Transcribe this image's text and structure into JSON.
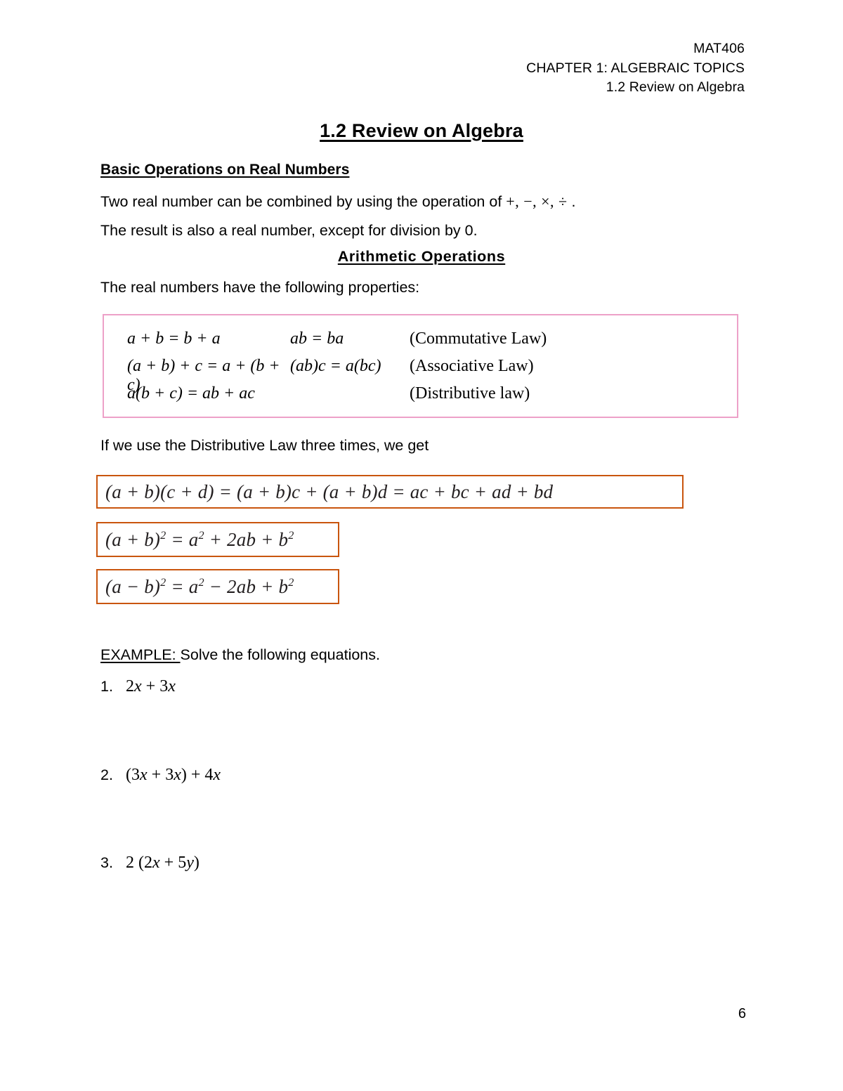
{
  "header": {
    "lines": [
      "MAT406",
      "CHAPTER 1: ALGEBRAIC TOPICS",
      "1.2 Review on Algebra"
    ]
  },
  "title": {
    "number": "1.2",
    "text": "Review on Algebra",
    "full": "1.2   Review on Algebra"
  },
  "section": {
    "heading": "Basic Operations on Real Numbers",
    "intro_1_pre": "Two real number can be combined by using the operation of ",
    "intro_1_ops": "+, −, ×, ÷",
    "intro_1_post": " .",
    "intro_2": "The result is also a real number, except for division by 0.",
    "subheading": "Arithmetic Operations",
    "properties_lead": "The real numbers have the following properties:"
  },
  "law_box": {
    "border_color": "#eda1c8",
    "rows": [
      {
        "eq1": "a + b = b + a",
        "eq2": "ab = ba",
        "name": "(Commutative Law)"
      },
      {
        "eq1": "(a + b) + c = a + (b + c)",
        "eq2": "(ab)c = a(bc)",
        "name": "(Associative Law)"
      },
      {
        "eq1": "a(b + c) = ab + ac",
        "eq2": "",
        "name": "(Distributive law)"
      }
    ]
  },
  "distributive_note": "If we use the Distributive Law three times, we get",
  "identities": {
    "border_color": "#c9550e",
    "items": [
      {
        "text": "(a + b)(c + d) = (a + b)c + (a + b)d = ac + bc + ad + bd",
        "has_superscripts": false
      },
      {
        "text": "(a + b)² = a² + 2ab + b²",
        "has_superscripts": true
      },
      {
        "text": "(a − b)² = a² − 2ab + b²",
        "has_superscripts": true
      }
    ]
  },
  "example": {
    "label": "EXAMPLE: ",
    "instruction": "Solve the following equations.",
    "questions": [
      {
        "number": "1.",
        "expression": "2x + 3x"
      },
      {
        "number": "2.",
        "expression": "(3x + 3x) + 4x"
      },
      {
        "number": "3.",
        "expression": "2 (2x + 5y)"
      }
    ]
  },
  "footer": {
    "page_number": "6"
  }
}
